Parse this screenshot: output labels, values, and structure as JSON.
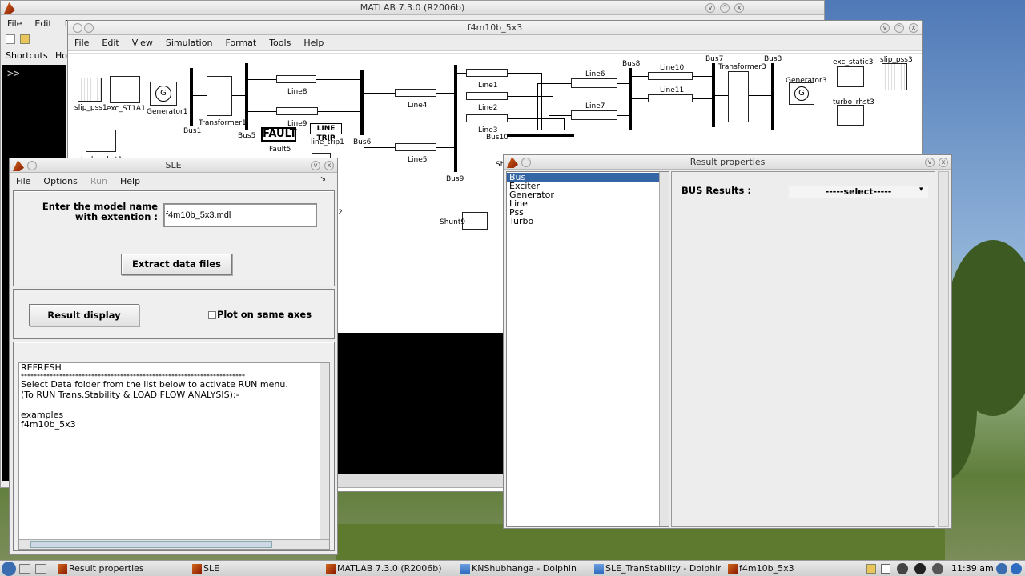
{
  "matlab_window": {
    "title": "MATLAB  7.3.0 (R2006b)",
    "menu": [
      "File",
      "Edit",
      "De"
    ],
    "shortcuts_label": "Shortcuts",
    "how_label": "Ho",
    "prompt": ">>"
  },
  "model_window": {
    "title": "f4m10b_5x3",
    "menu": [
      "File",
      "Edit",
      "View",
      "Simulation",
      "Format",
      "Tools",
      "Help"
    ],
    "blocks": {
      "slip_pss1": "slip_pss1",
      "exc_st1a1": "exc_ST1A1",
      "generator1": "Generator1",
      "transformer1": "Transformer1",
      "bus1": "Bus1",
      "bus5": "Bus5",
      "line8": "Line8",
      "line9": "Line9",
      "fault_text": "FAULT",
      "fault5": "Fault5",
      "line_trip_text": "LINE TRIP",
      "line_trip1": "line_trip1",
      "bus6": "Bus6",
      "line4": "Line4",
      "line5": "Line5",
      "bus9": "Bus9",
      "line1": "Line1",
      "line2": "Line2",
      "line3": "Line3",
      "bus10": "Bus10",
      "line6": "Line6",
      "line7": "Line7",
      "bus8": "Bus8",
      "line10": "Line10",
      "line11": "Line11",
      "bus7": "Bus7",
      "transformer3": "Transformer3",
      "bus3": "Bus3",
      "generator3": "Generator3",
      "exc_static3": "exc_static3",
      "slip_pss3": "slip_pss3",
      "turbo_rhst3": "turbo_rhst3",
      "shunt9": "Shunt9",
      "turbo_rhst1": "turbo_rhst1",
      "g_symbol": "G",
      "sh_partial": "Sh",
      "two": "2"
    }
  },
  "sle_window": {
    "title": "SLE",
    "menu": [
      "File",
      "Options",
      "Run",
      "Help"
    ],
    "model_label": "Enter the model name with extention :",
    "model_value": "f4m10b_5x3.mdl",
    "extract_button": "Extract data files",
    "result_button": "Result display",
    "plot_checkbox": "Plot on same axes",
    "plot_checked": false,
    "list_header": "REFRESH",
    "list_separator": "**********************************************************************",
    "list_lines": [
      "Select Data folder from the list below to activate RUN menu.",
      "(To RUN Trans.Stability & LOAD FLOW ANALYSIS):-",
      "",
      "examples",
      "f4m10b_5x3"
    ]
  },
  "result_window": {
    "title": "Result properties",
    "categories": [
      "Bus",
      "Exciter",
      "Generator",
      "Line",
      "Pss",
      "Turbo"
    ],
    "selected_index": 0,
    "results_label": "BUS Results :",
    "select_value": "-----select-----"
  },
  "taskbar": {
    "tasks": [
      "Result properties",
      "SLE",
      "MATLAB  7.3.0 (R2006b)",
      "KNShubhanga - Dolphin",
      "SLE_TranStability - Dolphin",
      "f4m10b_5x3"
    ],
    "clock": "11:39 am"
  },
  "colors": {
    "selection": "#3465a4",
    "titlebar": "#dcdcdc",
    "panel": "#efefef"
  }
}
